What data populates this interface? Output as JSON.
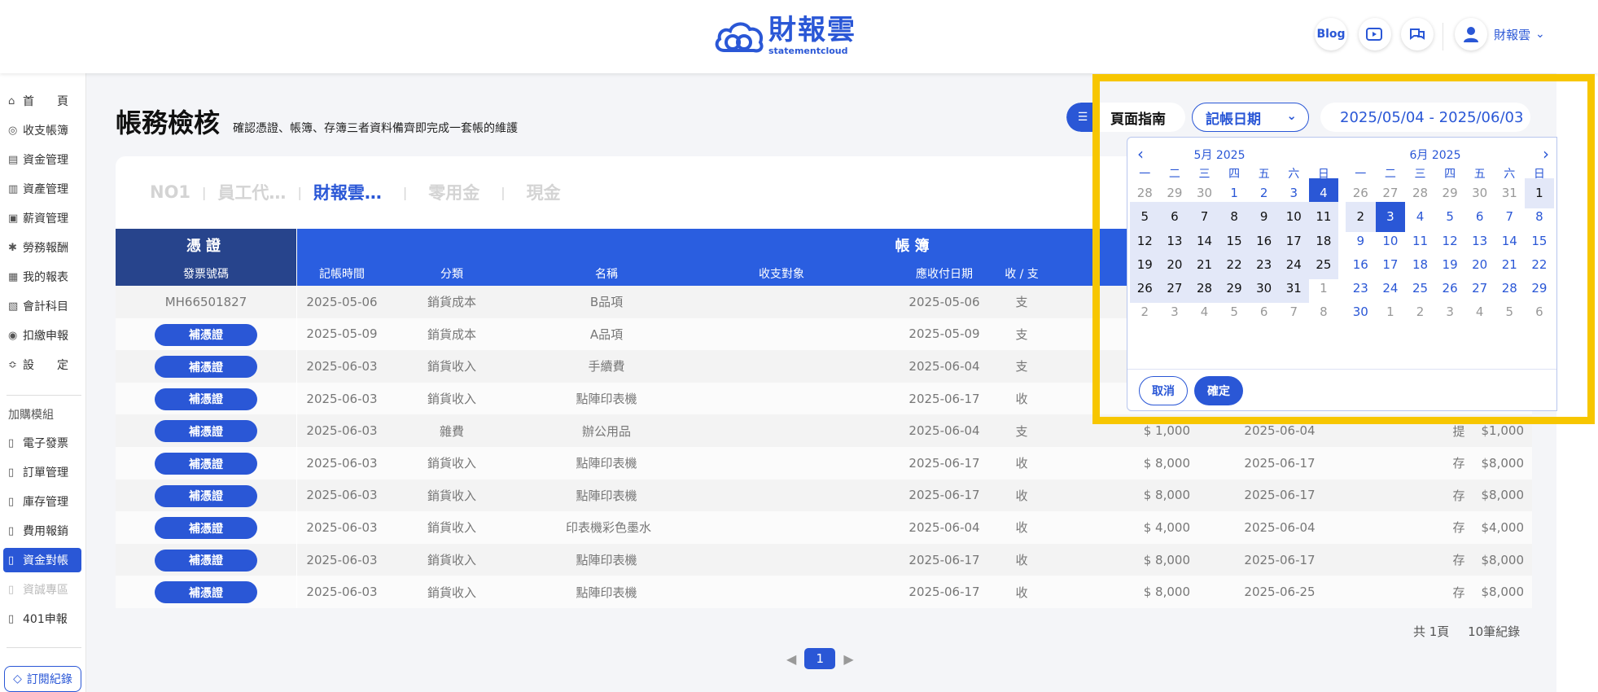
{
  "header": {
    "logo_title": "財報雲",
    "logo_sub": "statementcloud",
    "blog_label": "Blog",
    "user_name": "財報雲"
  },
  "sidebar": {
    "items": [
      {
        "label": "首　　頁",
        "icon": "home-icon"
      },
      {
        "label": "收支帳簿",
        "icon": "coin-icon"
      },
      {
        "label": "資金管理",
        "icon": "bank-icon"
      },
      {
        "label": "資產管理",
        "icon": "asset-icon"
      },
      {
        "label": "薪資管理",
        "icon": "salary-icon"
      },
      {
        "label": "勞務報酬",
        "icon": "labor-icon"
      },
      {
        "label": "我的報表",
        "icon": "report-icon"
      },
      {
        "label": "會計科目",
        "icon": "ledger-icon"
      },
      {
        "label": "扣繳申報",
        "icon": "tax-icon"
      },
      {
        "label": "設　　定",
        "icon": "settings-icon"
      }
    ],
    "section_label": "加購模組",
    "addon_items": [
      {
        "label": "電子發票"
      },
      {
        "label": "訂單管理"
      },
      {
        "label": "庫存管理"
      },
      {
        "label": "費用報銷"
      },
      {
        "label": "資金對帳"
      },
      {
        "label": "資誠專區"
      },
      {
        "label": "401申報"
      }
    ],
    "subscription_label": "訂閱紀錄"
  },
  "page": {
    "title": "帳務檢核",
    "subtitle": "確認憑證、帳簿、存簿三者資料備齊即完成一套帳的維護"
  },
  "controls": {
    "guide_label": "頁面指南",
    "date_type": "記帳日期",
    "date_range": "2025/05/04 - 2025/06/03"
  },
  "tabs": [
    "NO1",
    "員工代…",
    "財報雲…",
    "零用金",
    "現金"
  ],
  "table": {
    "group_voucher": "憑證",
    "group_ledger": "帳簿",
    "headers": {
      "invoice": "發票號碼",
      "record_time": "記帳時間",
      "category": "分類",
      "name": "名稱",
      "party": "收支對象",
      "due_date": "應收付日期",
      "inout": "收 / 支"
    },
    "supplement_label": "補憑證",
    "rows": [
      {
        "invoice": "MH66501827",
        "record_time": "2025-05-06",
        "category": "銷貨成本",
        "name": "B品項",
        "due_date": "2025-05-06",
        "inout": "支",
        "amount": "",
        "bank_date": "",
        "bank_type": "",
        "bank_amount": ""
      },
      {
        "invoice": "",
        "record_time": "2025-05-09",
        "category": "銷貨成本",
        "name": "A品項",
        "due_date": "2025-05-09",
        "inout": "支",
        "amount": "",
        "bank_date": "",
        "bank_type": "",
        "bank_amount": ""
      },
      {
        "invoice": "",
        "record_time": "2025-06-03",
        "category": "銷貨收入",
        "name": "手續費",
        "due_date": "2025-06-04",
        "inout": "支",
        "amount": "",
        "bank_date": "",
        "bank_type": "",
        "bank_amount": ""
      },
      {
        "invoice": "",
        "record_time": "2025-06-03",
        "category": "銷貨收入",
        "name": "點陣印表機",
        "due_date": "2025-06-17",
        "inout": "收",
        "amount": "",
        "bank_date": "",
        "bank_type": "",
        "bank_amount": ""
      },
      {
        "invoice": "",
        "record_time": "2025-06-03",
        "category": "雜費",
        "name": "辦公用品",
        "due_date": "2025-06-04",
        "inout": "支",
        "amount": "$ 1,000",
        "bank_date": "2025-06-04",
        "bank_type": "提",
        "bank_amount": "$1,000"
      },
      {
        "invoice": "",
        "record_time": "2025-06-03",
        "category": "銷貨收入",
        "name": "點陣印表機",
        "due_date": "2025-06-17",
        "inout": "收",
        "amount": "$ 8,000",
        "bank_date": "2025-06-17",
        "bank_type": "存",
        "bank_amount": "$8,000"
      },
      {
        "invoice": "",
        "record_time": "2025-06-03",
        "category": "銷貨收入",
        "name": "點陣印表機",
        "due_date": "2025-06-17",
        "inout": "收",
        "amount": "$ 8,000",
        "bank_date": "2025-06-17",
        "bank_type": "存",
        "bank_amount": "$8,000"
      },
      {
        "invoice": "",
        "record_time": "2025-06-03",
        "category": "銷貨收入",
        "name": "印表機彩色墨水",
        "due_date": "2025-06-04",
        "inout": "收",
        "amount": "$ 4,000",
        "bank_date": "2025-06-04",
        "bank_type": "存",
        "bank_amount": "$4,000"
      },
      {
        "invoice": "",
        "record_time": "2025-06-03",
        "category": "銷貨收入",
        "name": "點陣印表機",
        "due_date": "2025-06-17",
        "inout": "收",
        "amount": "$ 8,000",
        "bank_date": "2025-06-17",
        "bank_type": "存",
        "bank_amount": "$8,000"
      },
      {
        "invoice": "",
        "record_time": "2025-06-03",
        "category": "銷貨收入",
        "name": "點陣印表機",
        "due_date": "2025-06-17",
        "inout": "收",
        "amount": "$ 8,000",
        "bank_date": "2025-06-25",
        "bank_type": "存",
        "bank_amount": "$8,000"
      }
    ]
  },
  "footer": {
    "total_pages": "共 1頁",
    "total_records": "10筆紀錄",
    "current_page": "1"
  },
  "datepicker": {
    "left_month": "5月 2025",
    "right_month": "6月 2025",
    "weekdays": [
      "一",
      "二",
      "三",
      "四",
      "五",
      "六",
      "日"
    ],
    "left_days": [
      [
        "28",
        "29",
        "30",
        "1",
        "2",
        "3",
        "4"
      ],
      [
        "5",
        "6",
        "7",
        "8",
        "9",
        "10",
        "11"
      ],
      [
        "12",
        "13",
        "14",
        "15",
        "16",
        "17",
        "18"
      ],
      [
        "19",
        "20",
        "21",
        "22",
        "23",
        "24",
        "25"
      ],
      [
        "26",
        "27",
        "28",
        "29",
        "30",
        "31",
        "1"
      ],
      [
        "2",
        "3",
        "4",
        "5",
        "6",
        "7",
        "8"
      ]
    ],
    "right_days": [
      [
        "26",
        "27",
        "28",
        "29",
        "30",
        "31",
        "1"
      ],
      [
        "2",
        "3",
        "4",
        "5",
        "6",
        "7",
        "8"
      ],
      [
        "9",
        "10",
        "11",
        "12",
        "13",
        "14",
        "15"
      ],
      [
        "16",
        "17",
        "18",
        "19",
        "20",
        "21",
        "22"
      ],
      [
        "23",
        "24",
        "25",
        "26",
        "27",
        "28",
        "29"
      ],
      [
        "30",
        "1",
        "2",
        "3",
        "4",
        "5",
        "6"
      ]
    ],
    "cancel_label": "取消",
    "ok_label": "確定"
  },
  "colors": {
    "accent": "#2a57d6",
    "table_header": "#2a5ee0",
    "table_header_dark": "#27448c",
    "highlight": "#f7c600"
  }
}
